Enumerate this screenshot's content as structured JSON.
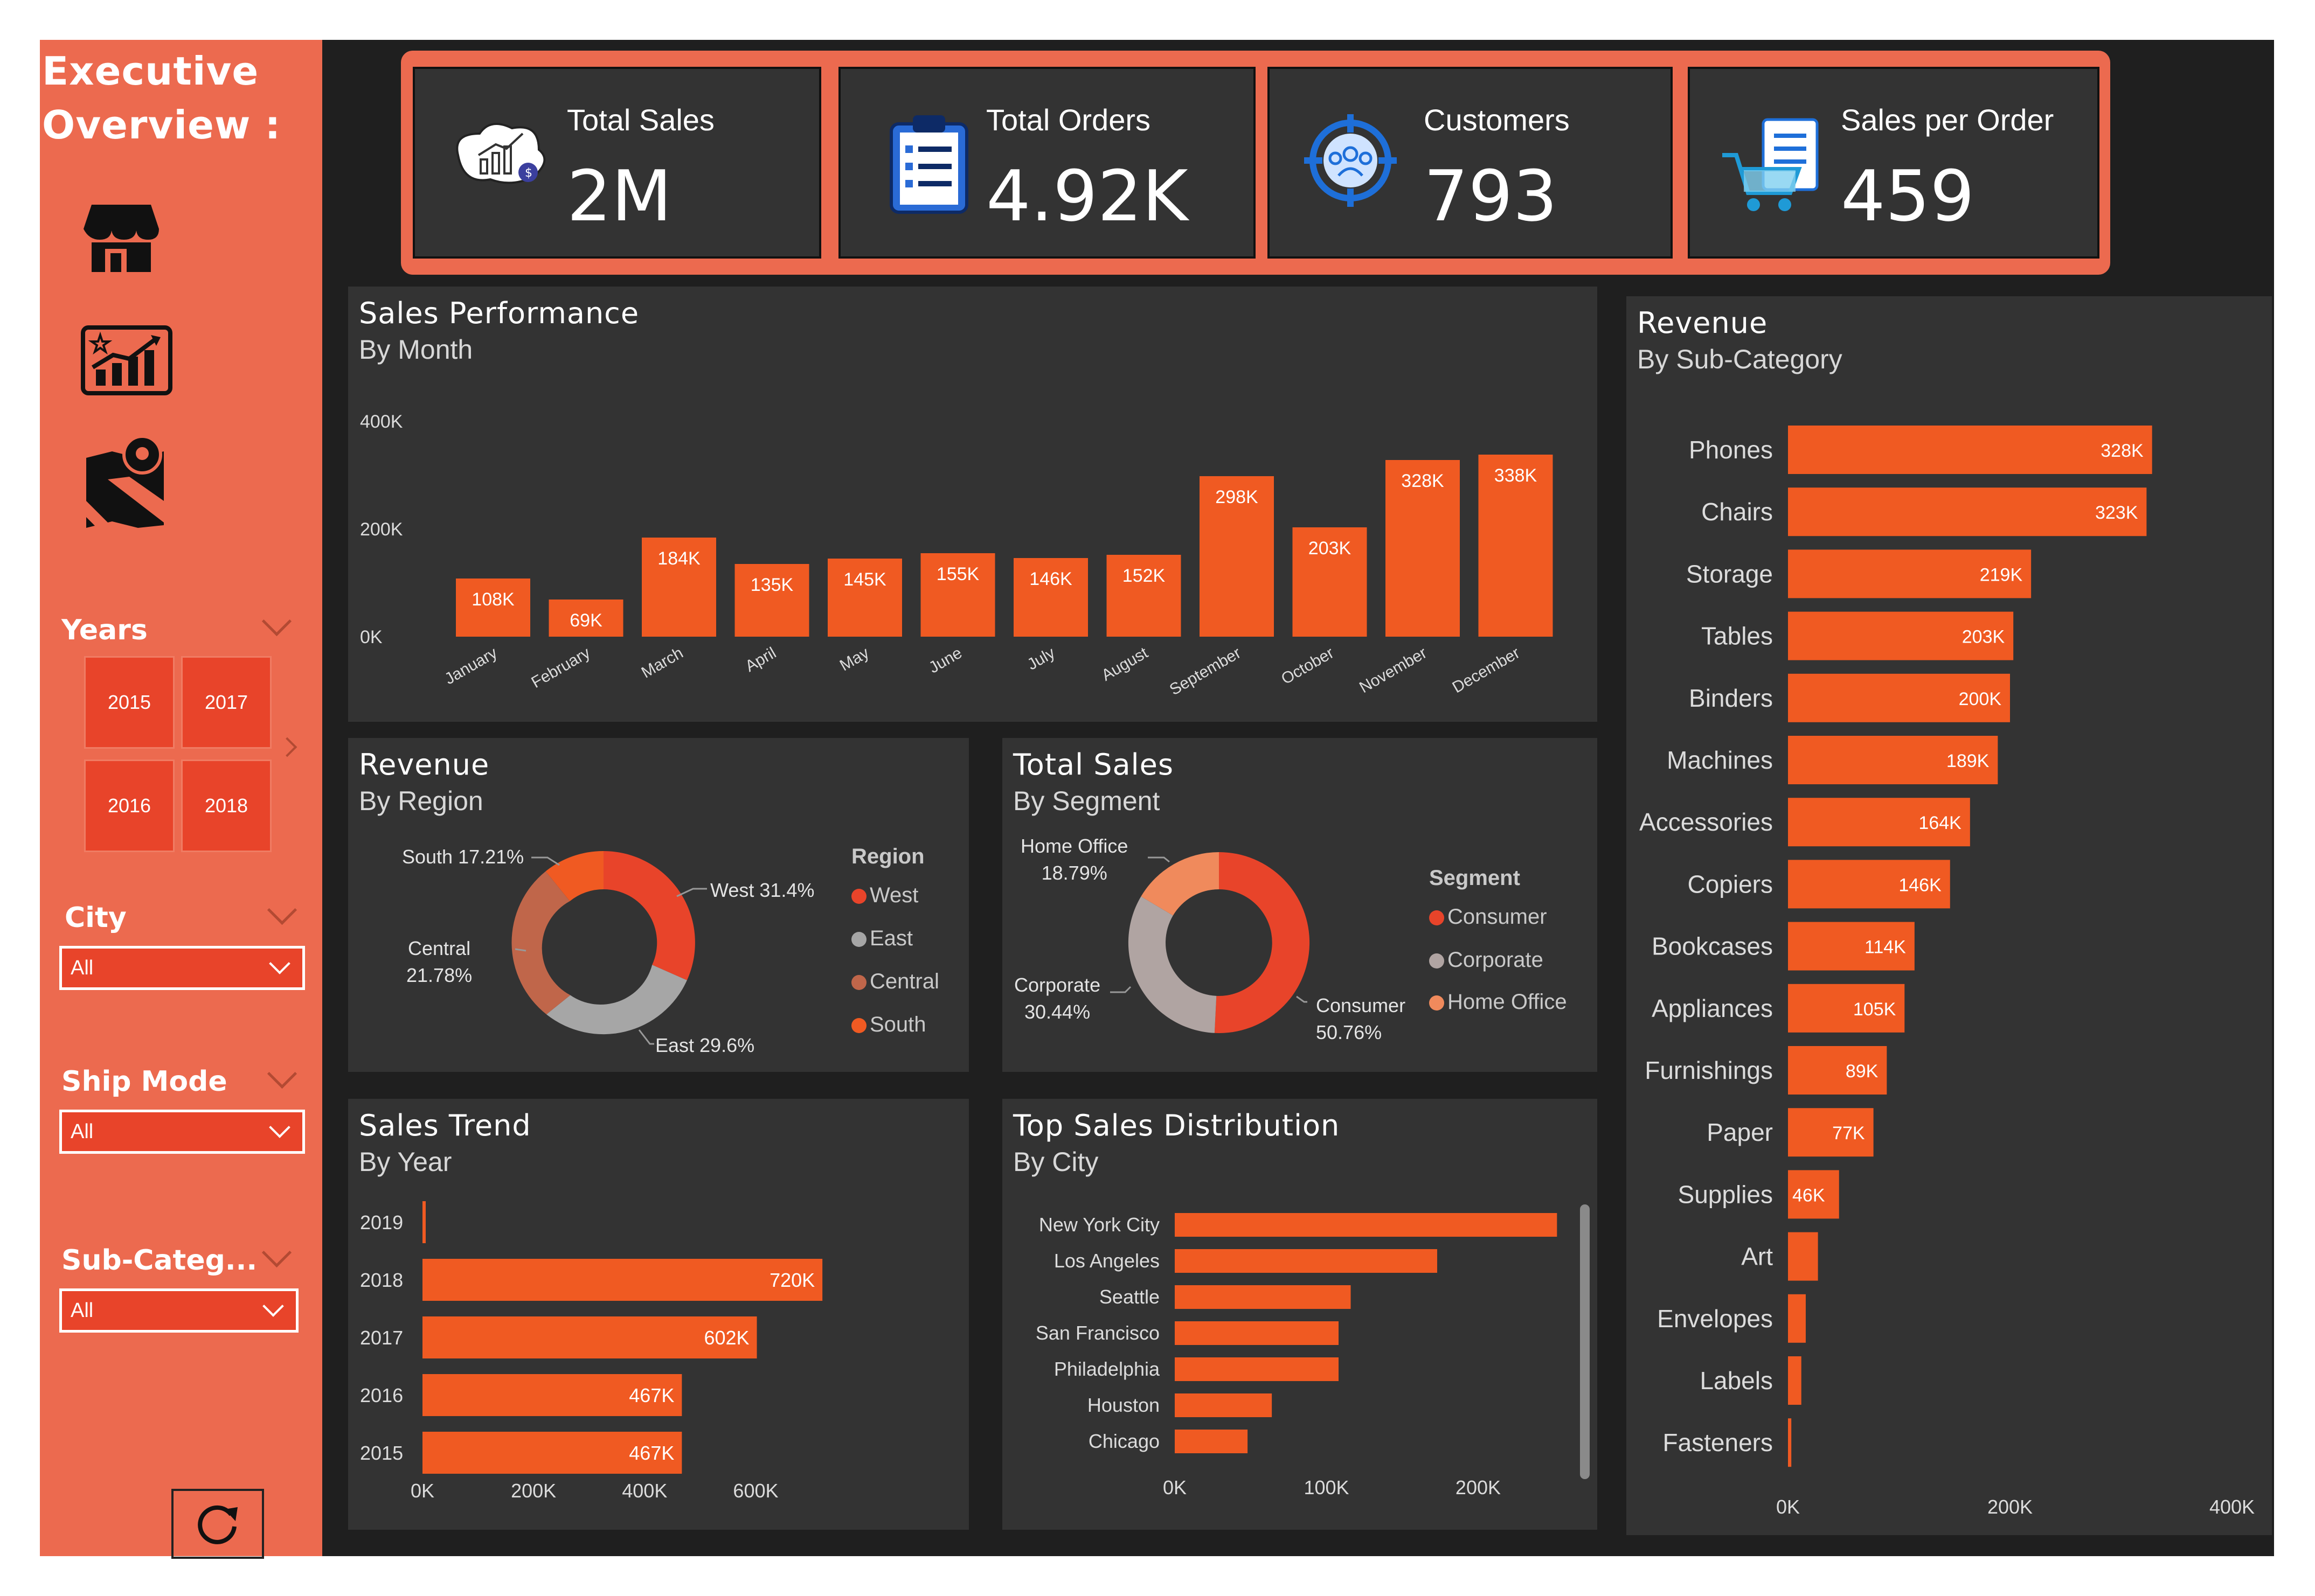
{
  "sidebar": {
    "title_line1": "Executive",
    "title_line2": "Overview :",
    "nav_icons": [
      "store-icon",
      "growth-chart-icon",
      "map-pin-icon"
    ],
    "filters": {
      "years": {
        "label": "Years",
        "options": [
          "2015",
          "2017",
          "2016",
          "2018"
        ]
      },
      "city": {
        "label": "City",
        "value": "All"
      },
      "ship_mode": {
        "label": "Ship Mode",
        "value": "All"
      },
      "sub_category": {
        "label": "Sub-Categ...",
        "value": "All"
      }
    },
    "reset_icon": "refresh-icon"
  },
  "kpis": [
    {
      "label": "Total Sales",
      "value": "2M",
      "icon": "sales-growth-icon"
    },
    {
      "label": "Total Orders",
      "value": "4.92K",
      "icon": "clipboard-list-icon"
    },
    {
      "label": "Customers",
      "value": "793",
      "icon": "customer-target-icon"
    },
    {
      "label": "Sales per Order",
      "value": "459",
      "icon": "cart-checklist-icon"
    }
  ],
  "colors": {
    "accent": "#ec6a4f",
    "bar": "#f05a22",
    "panel": "#333333",
    "background": "#1f1f1f"
  },
  "chart_data": [
    {
      "id": "sales_by_month",
      "type": "bar",
      "title": "Sales Performance",
      "subtitle": "By Month",
      "categories": [
        "January",
        "February",
        "March",
        "April",
        "May",
        "June",
        "July",
        "August",
        "September",
        "October",
        "November",
        "December"
      ],
      "values": [
        108,
        69,
        184,
        135,
        145,
        155,
        146,
        152,
        298,
        203,
        328,
        338
      ],
      "value_labels": [
        "108K",
        "69K",
        "184K",
        "135K",
        "145K",
        "155K",
        "146K",
        "152K",
        "298K",
        "203K",
        "328K",
        "338K"
      ],
      "y_ticks": [
        "400K",
        "200K",
        "0K"
      ],
      "ylim": [
        0,
        400
      ],
      "grid": false
    },
    {
      "id": "revenue_by_region",
      "type": "pie",
      "title": "Revenue",
      "subtitle": "By Region",
      "legend_title": "Region",
      "slices": [
        {
          "name": "West",
          "value": 31.4,
          "label": "West 31.4%",
          "color": "#e8442a"
        },
        {
          "name": "East",
          "value": 29.6,
          "label": "East 29.6%",
          "color": "#a6a6a6"
        },
        {
          "name": "Central",
          "value": 21.78,
          "label_line1": "Central",
          "label_line2": "21.78%",
          "color": "#c0664a"
        },
        {
          "name": "South",
          "value": 17.21,
          "label": "South 17.21%",
          "color": "#f05a22"
        }
      ]
    },
    {
      "id": "sales_by_segment",
      "type": "pie",
      "title": "Total Sales",
      "subtitle": "By Segment",
      "legend_title": "Segment",
      "slices": [
        {
          "name": "Consumer",
          "value": 50.76,
          "label_line1": "Consumer",
          "label_line2": "50.76%",
          "color": "#e8442a"
        },
        {
          "name": "Corporate",
          "value": 30.44,
          "label_line1": "Corporate",
          "label_line2": "30.44%",
          "color": "#b0a4a2"
        },
        {
          "name": "Home Office",
          "value": 18.79,
          "label_line1": "Home Office",
          "label_line2": "18.79%",
          "color": "#f08a5c"
        }
      ]
    },
    {
      "id": "sales_trend_by_year",
      "type": "bar",
      "orientation": "horizontal",
      "title": "Sales Trend",
      "subtitle": "By Year",
      "categories": [
        "2019",
        "2018",
        "2017",
        "2016",
        "2015"
      ],
      "values": [
        3,
        720,
        602,
        467,
        467
      ],
      "value_labels": [
        "",
        "720K",
        "602K",
        "467K",
        "467K"
      ],
      "x_ticks": [
        "0K",
        "200K",
        "400K",
        "600K"
      ],
      "xlim": [
        0,
        780
      ]
    },
    {
      "id": "top_sales_by_city",
      "type": "bar",
      "orientation": "horizontal",
      "title": "Top Sales Distribution",
      "subtitle": "By City",
      "categories": [
        "New York City",
        "Los Angeles",
        "Seattle",
        "San Francisco",
        "Philadelphia",
        "Houston",
        "Chicago"
      ],
      "values": [
        252,
        173,
        116,
        108,
        108,
        64,
        48
      ],
      "x_ticks": [
        "0K",
        "100K",
        "200K"
      ],
      "xlim": [
        0,
        270
      ]
    },
    {
      "id": "revenue_by_subcategory",
      "type": "bar",
      "orientation": "horizontal",
      "title": "Revenue",
      "subtitle": "By Sub-Category",
      "categories": [
        "Phones",
        "Chairs",
        "Storage",
        "Tables",
        "Binders",
        "Machines",
        "Accessories",
        "Copiers",
        "Bookcases",
        "Appliances",
        "Furnishings",
        "Paper",
        "Supplies",
        "Art",
        "Envelopes",
        "Labels",
        "Fasteners"
      ],
      "values": [
        328,
        323,
        219,
        203,
        200,
        189,
        164,
        146,
        114,
        105,
        89,
        77,
        46,
        27,
        16,
        12,
        3
      ],
      "value_labels": [
        "328K",
        "323K",
        "219K",
        "203K",
        "200K",
        "189K",
        "164K",
        "146K",
        "114K",
        "105K",
        "89K",
        "77K",
        "46K",
        "",
        "",
        "",
        ""
      ],
      "x_ticks": [
        "0K",
        "200K",
        "400K"
      ],
      "xlim": [
        0,
        400
      ]
    }
  ]
}
